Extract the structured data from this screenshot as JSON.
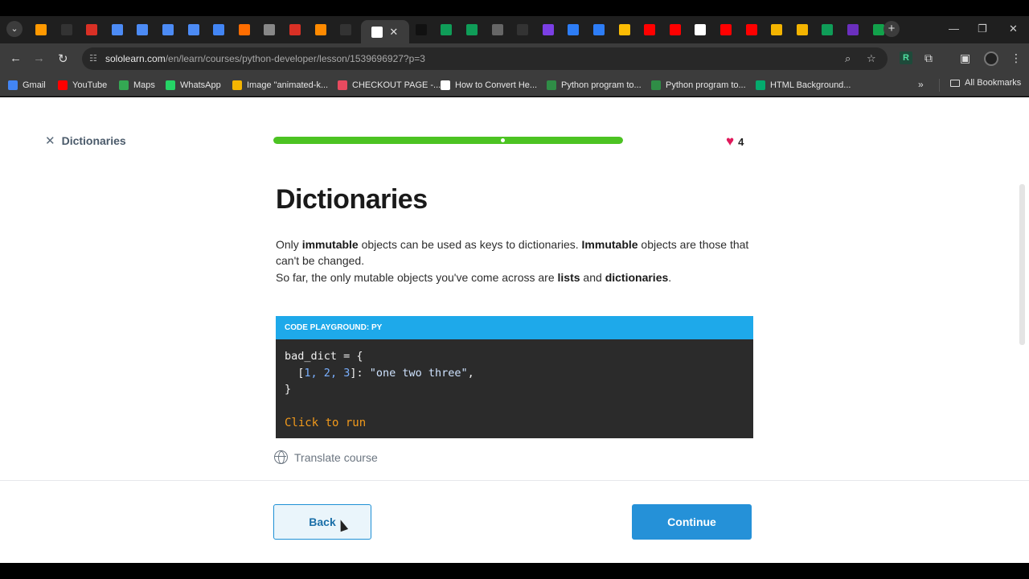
{
  "browser": {
    "url_host": "sololearn.com",
    "url_path": "/en/learn/courses/python-developer/lesson/1539696927?p=3",
    "tab_favicon_colors": [
      "#ff9900",
      "#333",
      "#d93025",
      "#4c8bf5",
      "#4c8bf5",
      "#4c8bf5",
      "#4c8bf5",
      "#4285f4",
      "#ff6d00",
      "#888",
      "#d93025",
      "#ff8a00",
      "#333",
      "#111",
      "#0f9d58",
      "#0f9d58",
      "#666",
      "#333",
      "#7b3fe4",
      "#2d7df6",
      "#2d7df6",
      "#fbbc04",
      "#ff0000",
      "#ff0000",
      "#ffffff",
      "#ff0000",
      "#ff0000",
      "#f4b400",
      "#f4b400",
      "#0f9d58",
      "#6b2fbe",
      "#12a14b"
    ],
    "active_tab_favicon": "#ffffff"
  },
  "bookmarks": [
    {
      "label": "Gmail",
      "color": "#4285f4"
    },
    {
      "label": "YouTube",
      "color": "#ff0000"
    },
    {
      "label": "Maps",
      "color": "#34a853"
    },
    {
      "label": "WhatsApp",
      "color": "#25d366"
    },
    {
      "label": "Image \"animated-k...",
      "color": "#f4b400"
    },
    {
      "label": "CHECKOUT PAGE -...",
      "color": "#e84a5f"
    },
    {
      "label": "How to Convert He...",
      "color": "#ffffff"
    },
    {
      "label": "Python program to...",
      "color": "#2f8d46"
    },
    {
      "label": "Python program to...",
      "color": "#2f8d46"
    },
    {
      "label": "HTML Background...",
      "color": "#04aa6d"
    }
  ],
  "all_bookmarks_label": "All Bookmarks",
  "lesson": {
    "exit_label": "Dictionaries",
    "progress_fraction": 1.0,
    "hearts": "4",
    "title": "Dictionaries",
    "p1_a": "Only ",
    "p1_b": "immutable",
    "p1_c": " objects can be used as keys to dictionaries. ",
    "p1_d": "Immutable",
    "p1_e": " objects are those that can't be changed.",
    "p2_a": "So far, the only mutable objects you've come across are ",
    "p2_b": "lists",
    "p2_c": " and ",
    "p2_d": "dictionaries",
    "p2_e": "."
  },
  "playground": {
    "header": "CODE PLAYGROUND: PY",
    "line1": "bad_dict = {",
    "line2_open": "  [",
    "line2_n1": "1",
    "line2_c1": ", ",
    "line2_n2": "2",
    "line2_c2": ", ",
    "line2_n3": "3",
    "line2_close": "]: ",
    "line2_str": "\"one two three\"",
    "line2_end": ",",
    "line3": "}",
    "run": "Click to run"
  },
  "translate_label": "Translate course",
  "buttons": {
    "back": "Back",
    "continue": "Continue"
  }
}
